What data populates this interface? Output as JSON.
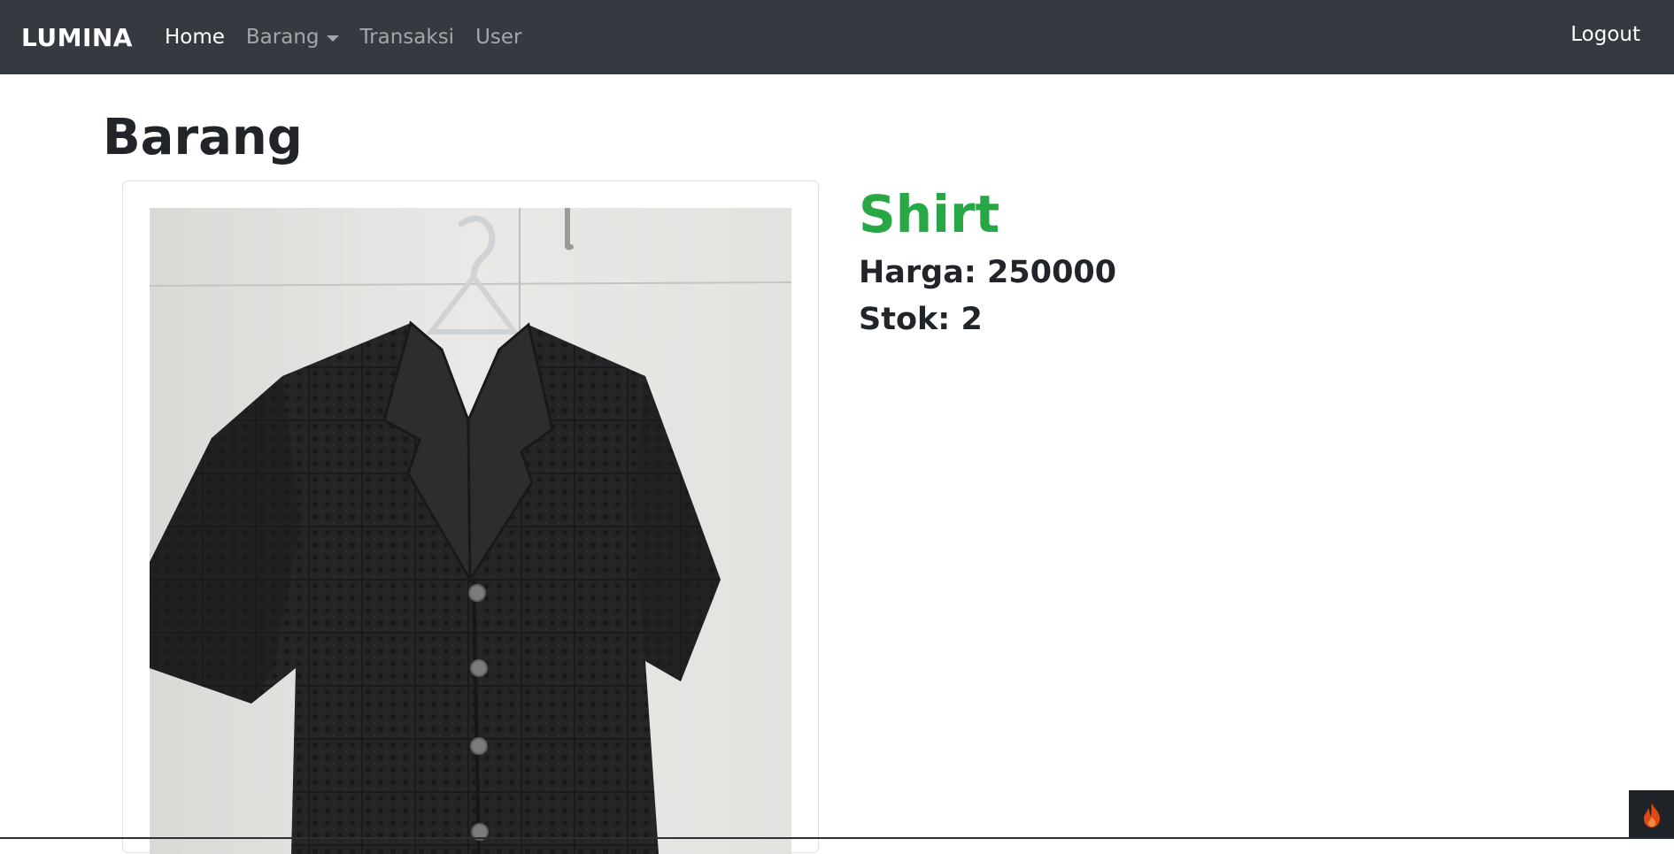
{
  "navbar": {
    "brand": "LUMINA",
    "links": [
      {
        "label": "Home",
        "active": true
      },
      {
        "label": "Barang",
        "dropdown": true
      },
      {
        "label": "Transaksi"
      },
      {
        "label": "User"
      }
    ],
    "logout": "Logout"
  },
  "page": {
    "title": "Barang"
  },
  "product": {
    "name": "Shirt",
    "price_line": "Harga: 250000",
    "stock_line": "Stok: 2",
    "image_icon": "black-crochet-shirt-photo"
  },
  "toolbar": {
    "icon": "flame-icon",
    "accent": "#dd4814"
  },
  "colors": {
    "navbar": "#343a40",
    "product_name": "#28a745"
  }
}
